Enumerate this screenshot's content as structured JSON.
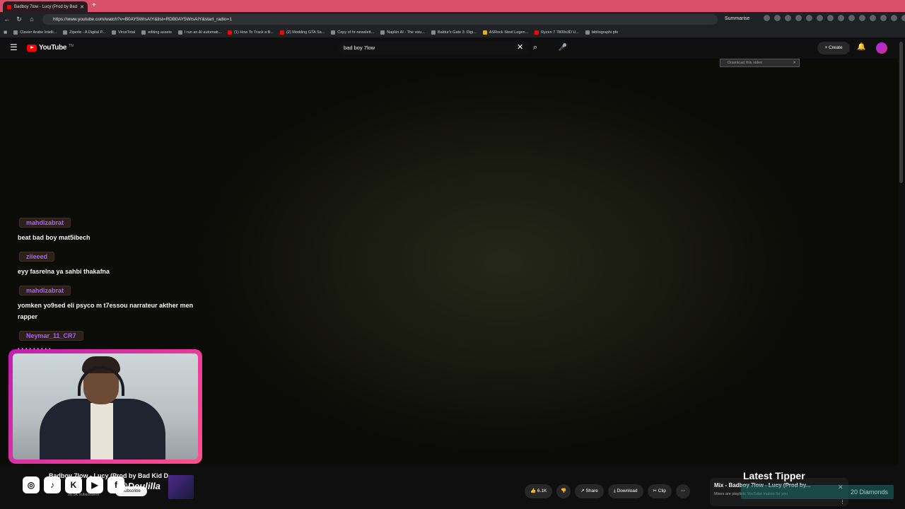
{
  "browser": {
    "tab_title": "Badboy 7low - Lucy (Prod by Bad",
    "tab_close": "✕",
    "new_tab": "+",
    "url": "https://www.youtube.com/watch?v=B0AY5WrsAIY&list=RDB0AY5WrsAIY&start_radio=1",
    "summarise_label": "Summarise",
    "bookmarks": [
      "Clavier Arabe Intelli...",
      "Ziperto - A Digital P...",
      "VirusTotal",
      "editing assets",
      "I run an AI automati...",
      "(1) How To Track a B...",
      "(2) Modding GTA Sa...",
      "Copy of hr-newslett...",
      "Napkin AI - The visu...",
      "Baldur's Gate 3: Digi...",
      "ASRock Steel Legen...",
      "Ryzen 7 7800x3D U...",
      "bibliographi pfe"
    ]
  },
  "youtube": {
    "logo_text": "YouTube",
    "logo_region": "TN",
    "search_value": "bad boy 7low",
    "create_label": "Create",
    "download_badge": "Download this video"
  },
  "chat": [
    {
      "user": "mahdizabrat",
      "message": "beat bad boy mat5ibech"
    },
    {
      "user": "ziieeed",
      "message": "eyy fasrelna ya sahbi thakafna"
    },
    {
      "user": "mahdizabrat",
      "message": "yomken yo9sed eli psyco m t7essou narrateur akther men rapper"
    },
    {
      "user": "Neymar_11_CR7",
      "message": "hhhhhhhhh"
    }
  ],
  "overlay": {
    "handle": "@Deulilla",
    "latest_tipper": "Latest Tipper",
    "diamonds": "20 Diamonds"
  },
  "video": {
    "title": "Badboy 7low - Lucy (Prod by Bad Kid D...",
    "subscribers": "28.5K subscribers",
    "subscribe": "Subscribe",
    "likes": "6.1K",
    "share": "Share",
    "download": "Download",
    "clip": "Clip",
    "more": "⋯"
  },
  "miniplayer": {
    "title": "Mix - Badboy 7low - Lucy (Prod by...",
    "subtitle": "Mixes are playlists YouTube makes for you"
  }
}
